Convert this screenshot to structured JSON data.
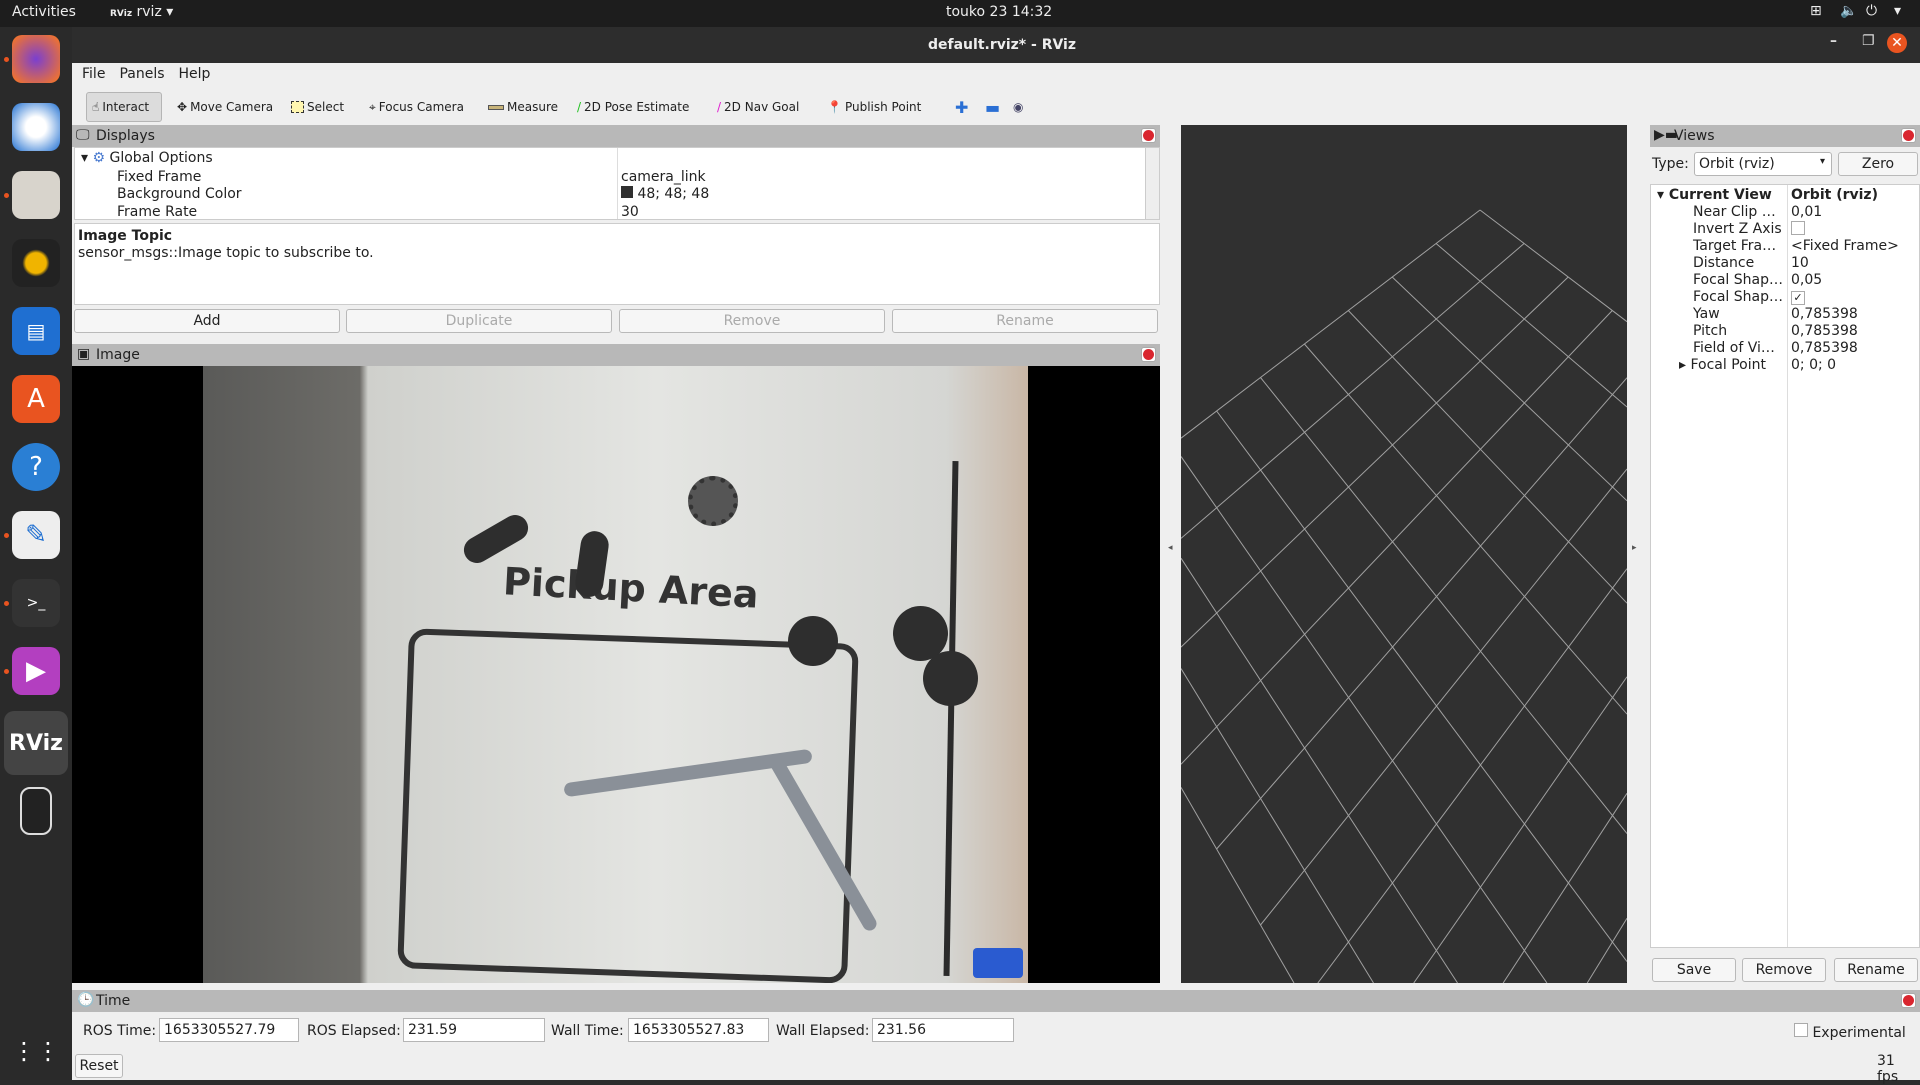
{
  "topbar": {
    "activities": "Activities",
    "app_menu": "rviz",
    "clock": "touko 23  14:32"
  },
  "window": {
    "title": "default.rviz* - RViz"
  },
  "menu": [
    "File",
    "Panels",
    "Help"
  ],
  "toolbar": [
    "Interact",
    "Move Camera",
    "Select",
    "Focus Camera",
    "Measure",
    "2D Pose Estimate",
    "2D Nav Goal",
    "Publish Point"
  ],
  "displays": {
    "title": "Displays",
    "global": "Global Options",
    "props": [
      {
        "k": "Fixed Frame",
        "v": "camera_link"
      },
      {
        "k": "Background Color",
        "v": "48; 48; 48"
      },
      {
        "k": "Frame Rate",
        "v": "30"
      }
    ],
    "desc_title": "Image Topic",
    "desc": "sensor_msgs::Image topic to subscribe to.",
    "buttons": [
      "Add",
      "Duplicate",
      "Remove",
      "Rename"
    ]
  },
  "image_panel": {
    "title": "Image",
    "overlay_text": "Pickup Area"
  },
  "views": {
    "title": "Views",
    "type_label": "Type:",
    "type_value": "Orbit (rviz)",
    "zero": "Zero",
    "header": {
      "k": "Current View",
      "v": "Orbit (rviz)"
    },
    "props": [
      {
        "k": "Near Clip …",
        "v": "0,01"
      },
      {
        "k": "Invert Z Axis",
        "v": ""
      },
      {
        "k": "Target Fra…",
        "v": "<Fixed Frame>"
      },
      {
        "k": "Distance",
        "v": "10"
      },
      {
        "k": "Focal Shap…",
        "v": "0,05"
      },
      {
        "k": "Focal Shap…",
        "v": "✓"
      },
      {
        "k": "Yaw",
        "v": "0,785398"
      },
      {
        "k": "Pitch",
        "v": "0,785398"
      },
      {
        "k": "Field of Vi…",
        "v": "0,785398"
      },
      {
        "k": "Focal Point",
        "v": "0; 0; 0"
      }
    ],
    "buttons": [
      "Save",
      "Remove",
      "Rename"
    ]
  },
  "time": {
    "title": "Time",
    "ros_time_label": "ROS Time:",
    "ros_time": "1653305527.79",
    "ros_elapsed_label": "ROS Elapsed:",
    "ros_elapsed": "231.59",
    "wall_time_label": "Wall Time:",
    "wall_time": "1653305527.83",
    "wall_elapsed_label": "Wall Elapsed:",
    "wall_elapsed": "231.56",
    "reset": "Reset",
    "experimental": "Experimental",
    "fps": "31 fps"
  }
}
